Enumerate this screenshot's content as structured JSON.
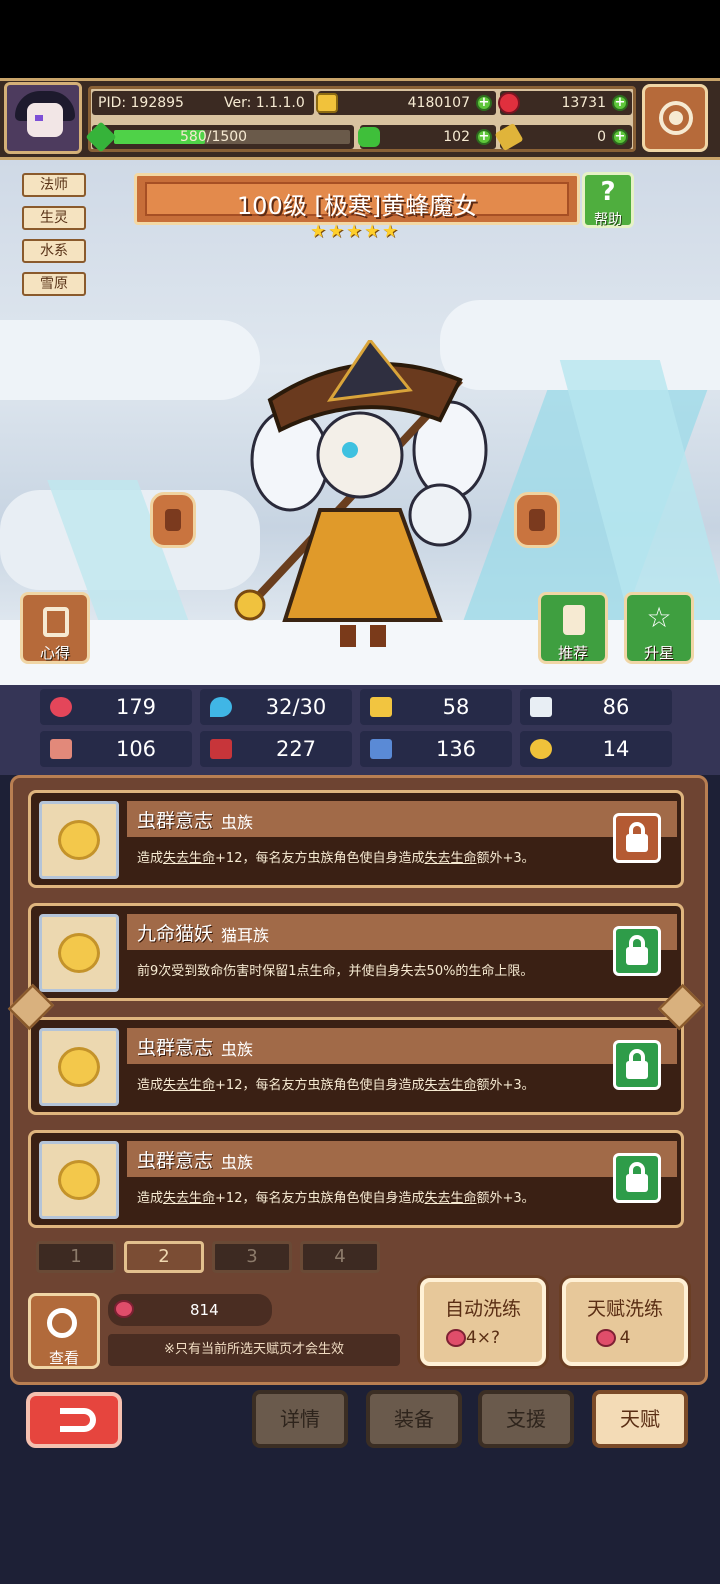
{
  "hud": {
    "pid": "PID: 192895",
    "version": "Ver: 1.1.1.0",
    "coins": "4180107",
    "gems": "13731",
    "xp": "580/1500",
    "xp_progress": 0.387,
    "clovers": "102",
    "keys": "0"
  },
  "tags": [
    "法师",
    "生灵",
    "水系",
    "雪原"
  ],
  "hero": {
    "title": "100级  [极寒]黄蜂魔女",
    "stars": 5,
    "help_label": "帮助"
  },
  "side_buttons": {
    "notes": "心得",
    "recommend": "推荐",
    "star_up": "升星"
  },
  "stats": {
    "hp": "179",
    "mana": "32/30",
    "defense": "58",
    "speed": "86",
    "attack": "106",
    "magic": "227",
    "armor": "136",
    "crit": "14"
  },
  "talents": [
    {
      "name": "虫群意志",
      "race": "虫族",
      "desc_a": "造成",
      "desc_link1": "失去生命",
      "desc_b": "+12，每名友方虫族角色使自身造成",
      "desc_link2": "失去生命",
      "desc_c": "额外+3。",
      "lock": "open"
    },
    {
      "name": "九命猫妖",
      "race": "猫耳族",
      "desc_a": "前9次受到致命伤害时保留1点生命，并使自身失去50%的生命上限。",
      "desc_link1": "",
      "desc_b": "",
      "desc_link2": "",
      "desc_c": "",
      "lock": "closed"
    },
    {
      "name": "虫群意志",
      "race": "虫族",
      "desc_a": "造成",
      "desc_link1": "失去生命",
      "desc_b": "+12，每名友方虫族角色使自身造成",
      "desc_link2": "失去生命",
      "desc_c": "额外+3。",
      "lock": "closed"
    },
    {
      "name": "虫群意志",
      "race": "虫族",
      "desc_a": "造成",
      "desc_link1": "失去生命",
      "desc_b": "+12，每名友方虫族角色使自身造成",
      "desc_link2": "失去生命",
      "desc_c": "额外+3。",
      "lock": "closed"
    }
  ],
  "pages": [
    "1",
    "2",
    "3",
    "4"
  ],
  "active_page": "2",
  "footer": {
    "view_label": "查看",
    "berries": "814",
    "note": "※只有当前所选天赋页才会生效",
    "auto_reroll": "自动洗练",
    "auto_cost": "4×?",
    "talent_reroll": "天赋洗练",
    "talent_cost": "4"
  },
  "nav": {
    "details": "详情",
    "equipment": "装备",
    "support": "支援",
    "talent": "天赋"
  },
  "colors": {
    "accent_gold": "#dfb57e",
    "panel_brown": "#6e4432",
    "lock_green": "#2e9c49",
    "lock_open": "#b45a33",
    "back_red": "#e6453e"
  }
}
